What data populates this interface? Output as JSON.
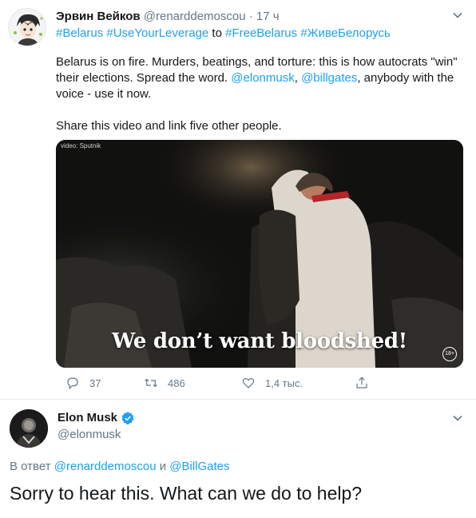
{
  "tweet1": {
    "author_name": "Эрвин Вейков",
    "author_handle": "@renarddemoscou",
    "separator": "·",
    "time": "17 ч",
    "tags": {
      "tag1": "#Belarus",
      "tag2": "#UseYourLeverage",
      "to_word": "to",
      "tag3": "#FreeBelarus",
      "tag4": "#ЖивеБелорусь"
    },
    "body": {
      "part1": "Belarus is on fire. Murders, beatings, and torture: this is how autocrats \"win\" their elections. Spread the word. ",
      "mention1": "@elonmusk",
      "comma": ", ",
      "mention2": "@billgates",
      "part2": ", anybody with the voice - use it now."
    },
    "share_text": "Share this video and link five other people.",
    "video": {
      "source_label": "video: Sputnik",
      "subtitle": "We don’t want bloodshed!",
      "rating": "18+"
    },
    "actions": {
      "reply_count": "37",
      "retweet_count": "486",
      "like_count": "1,4 тыс."
    },
    "icons": [
      "chevron-down-icon",
      "reply-icon",
      "retweet-icon",
      "heart-icon",
      "share-icon"
    ]
  },
  "tweet2": {
    "author_name": "Elon Musk",
    "author_handle": "@elonmusk",
    "reply_prefix": "В ответ ",
    "reply_user1": "@renarddemoscou",
    "reply_and": " и ",
    "reply_user2": "@BillGates",
    "text": "Sorry to hear this. What can we do to help?",
    "icons": [
      "verified-badge-icon",
      "chevron-down-icon"
    ]
  },
  "colors": {
    "link": "#1da1f2",
    "secondary_text": "#657786",
    "primary_text": "#14171a",
    "divider": "#e6ecf0"
  }
}
